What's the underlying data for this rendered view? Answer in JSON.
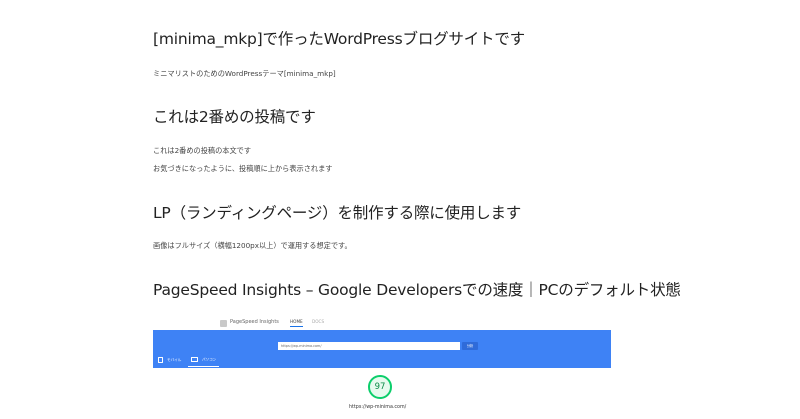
{
  "posts": [
    {
      "title": "[minima_mkp]で作ったWordPressブログサイトです",
      "lines": [
        "ミニマリストのためのWordPressテーマ[minima_mkp]"
      ]
    },
    {
      "title": "これは2番めの投稿です",
      "lines": [
        "これは2番めの投稿の本文です",
        "お気づきになったように、投稿順に上から表示されます"
      ]
    },
    {
      "title": "LP（ランディングページ）を制作する際に使用します",
      "lines": [
        "画像はフルサイズ（横幅1200px以上）で運用する想定です。"
      ]
    },
    {
      "title": "PageSpeed Insights – Google Developersでの速度｜PCのデフォルト状態",
      "lines": []
    }
  ],
  "screenshot": {
    "logo_text": "PageSpeed Insights",
    "tabs": [
      "HOME",
      "DOCS"
    ],
    "url_value": "https://wp-minima.com/",
    "analyze_label": "分析",
    "device_mobile": "モバイル",
    "device_desktop": "パソコン",
    "score": "97",
    "score_url": "https://wp-minima.com/",
    "banner_color": "#3e82f5",
    "score_color": "#0cce6b"
  }
}
